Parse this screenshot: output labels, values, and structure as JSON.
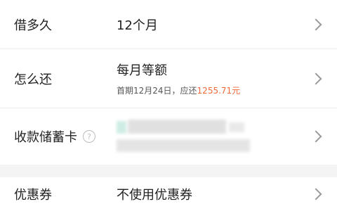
{
  "loan": {
    "term": {
      "label": "借多久",
      "value": "12个月"
    },
    "repayment": {
      "label": "怎么还",
      "value": "每月等额",
      "detail_prefix": "首期12月24日，应还",
      "detail_amount": "1255.71元"
    },
    "card": {
      "label": "收款储蓄卡",
      "help_icon": "question-circle-icon"
    },
    "coupon": {
      "label": "优惠券",
      "value": "不使用优惠券"
    }
  },
  "colors": {
    "accent": "#ef6a3a",
    "chevron": "#9a9a9a"
  }
}
